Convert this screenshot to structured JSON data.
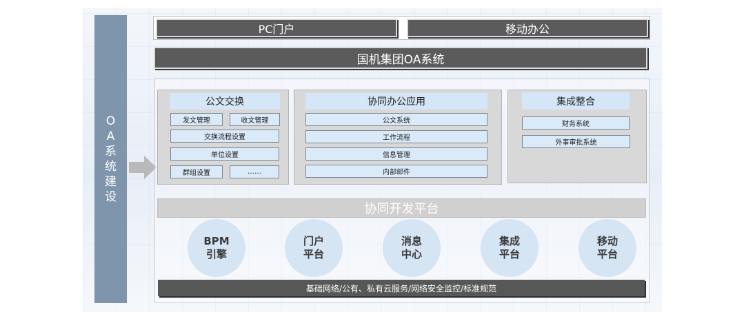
{
  "sidebar": {
    "label": "OA系统建设"
  },
  "top": {
    "pc_portal": "PC门户",
    "mobile_office": "移动办公"
  },
  "oa_system": "国机集团OA系统",
  "groups": {
    "doc_exchange": {
      "title": "公文交换",
      "items": [
        "发文管理",
        "收文管理",
        "交换流程设置",
        "单位设置",
        "群组设置",
        "……"
      ]
    },
    "collab_apps": {
      "title": "协同办公应用",
      "items": [
        "公文系统",
        "工作流程",
        "信息管理",
        "内部邮件"
      ]
    },
    "integration": {
      "title": "集成整合",
      "items": [
        "财务系统",
        "外事审批系统"
      ]
    }
  },
  "dev_platform": "协同开发平台",
  "platforms": [
    {
      "line1": "BPM",
      "line2": "引擎"
    },
    {
      "line1": "门户",
      "line2": "平台"
    },
    {
      "line1": "消息",
      "line2": "中心"
    },
    {
      "line1": "集成",
      "line2": "平台"
    },
    {
      "line1": "移动",
      "line2": "平台"
    }
  ],
  "base_infrastructure": "基础网络/公有、私有云服务/网络安全监控/标准规范",
  "colors": {
    "sidebar": "#7f95ab",
    "dark_bar": "#5b5b5b",
    "light_blue": "#d4e6f7",
    "group_gray": "#d8d8d8",
    "circle_blue": "#d6e5f4"
  }
}
